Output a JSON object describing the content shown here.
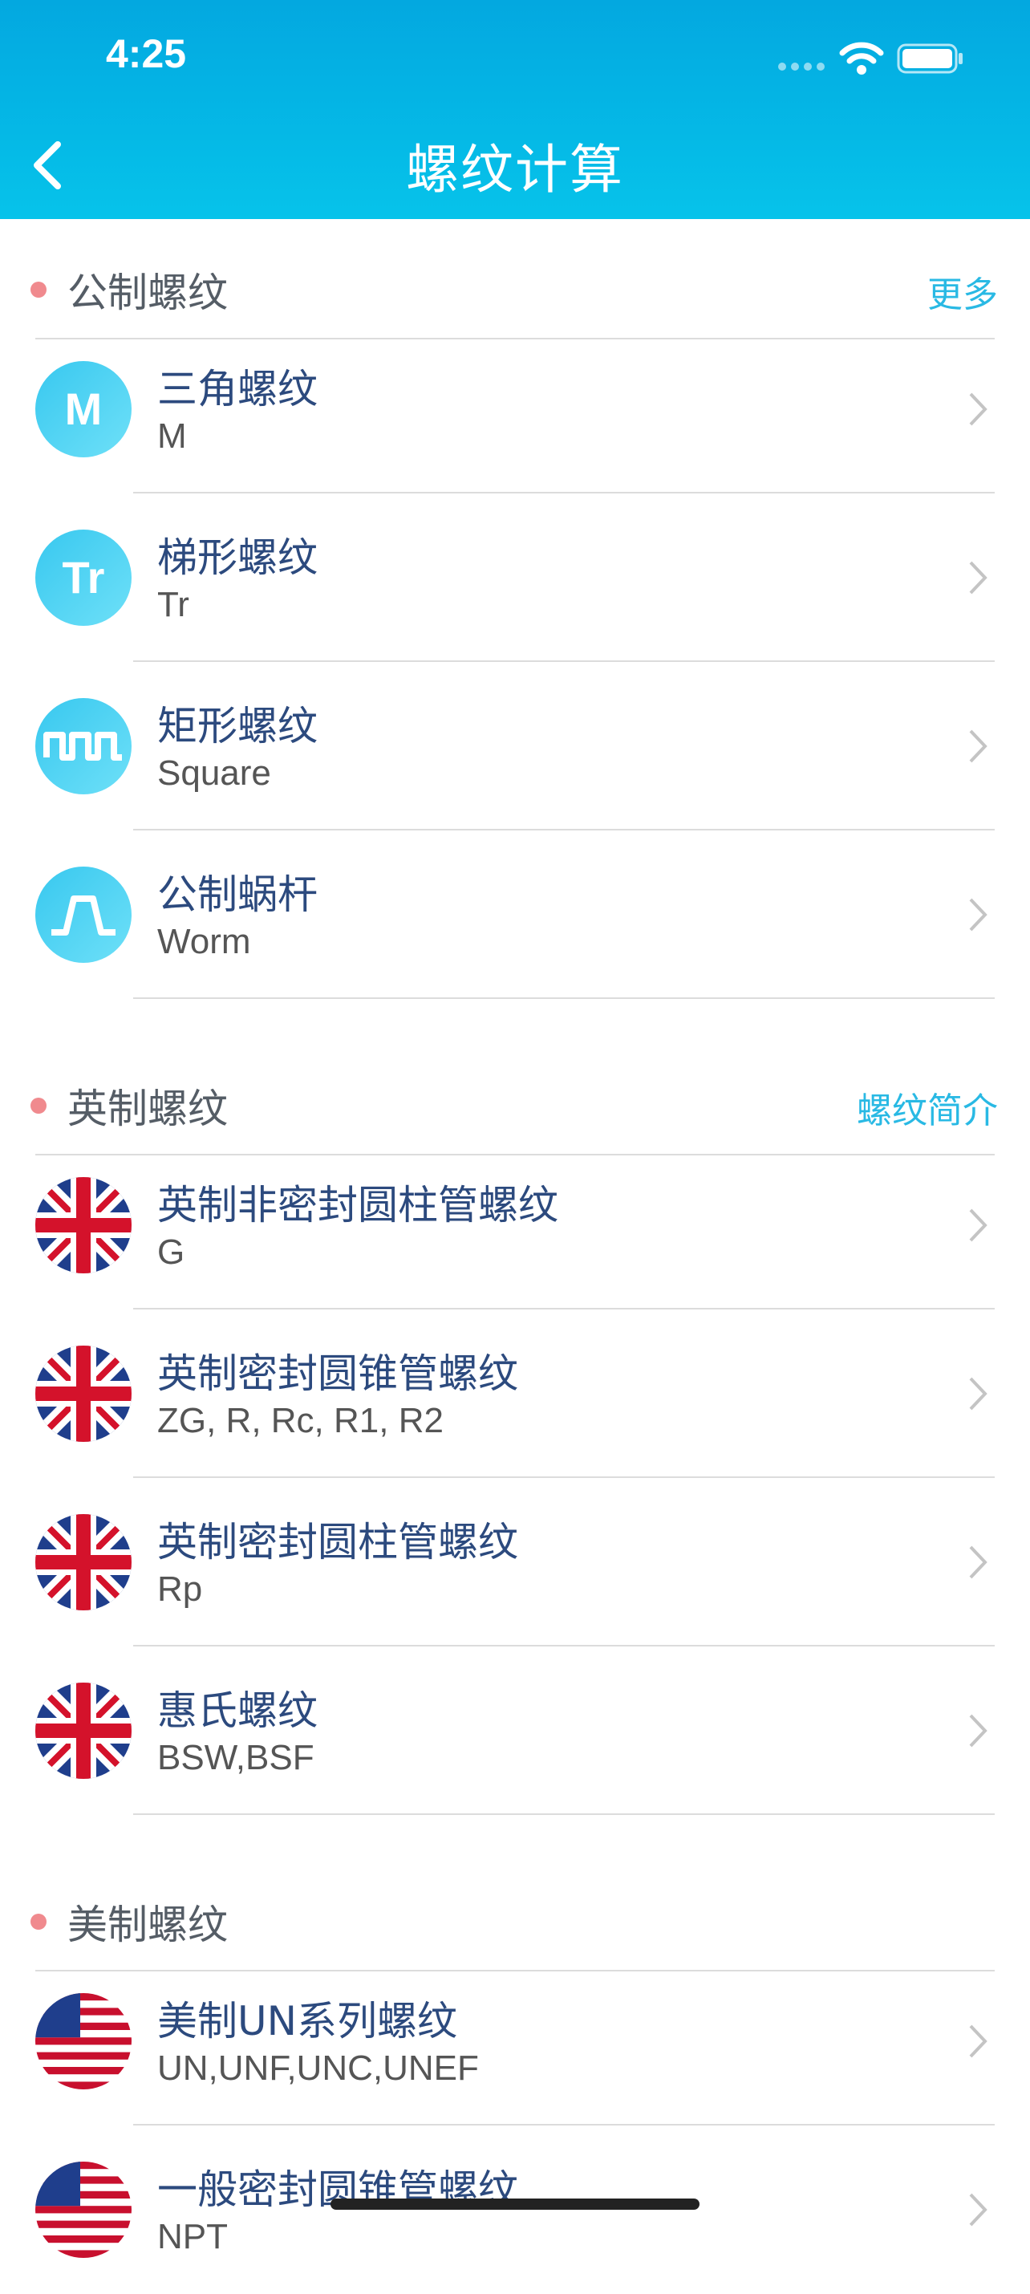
{
  "status_bar": {
    "time": "4:25"
  },
  "nav": {
    "title": "螺纹计算"
  },
  "sections": [
    {
      "title": "公制螺纹",
      "link": "更多",
      "items": [
        {
          "icon": "letter-m-icon",
          "letters": "M",
          "title": "三角螺纹",
          "subtitle": "M"
        },
        {
          "icon": "letter-tr-icon",
          "letters": "Tr",
          "title": "梯形螺纹",
          "subtitle": "Tr"
        },
        {
          "icon": "square-wave-icon",
          "title": "矩形螺纹",
          "subtitle": "Square"
        },
        {
          "icon": "worm-profile-icon",
          "title": "公制蜗杆",
          "subtitle": "Worm"
        }
      ]
    },
    {
      "title": "英制螺纹",
      "link": "螺纹简介",
      "items": [
        {
          "icon": "uk-flag-icon",
          "title": "英制非密封圆柱管螺纹",
          "subtitle": "G"
        },
        {
          "icon": "uk-flag-icon",
          "title": "英制密封圆锥管螺纹",
          "subtitle": "ZG, R, Rc, R1, R2"
        },
        {
          "icon": "uk-flag-icon",
          "title": "英制密封圆柱管螺纹",
          "subtitle": "Rp"
        },
        {
          "icon": "uk-flag-icon",
          "title": "惠氏螺纹",
          "subtitle": "BSW,BSF"
        }
      ]
    },
    {
      "title": "美制螺纹",
      "items": [
        {
          "icon": "us-flag-icon",
          "title": "美制UN系列螺纹",
          "subtitle": "UN,UNF,UNC,UNEF"
        },
        {
          "icon": "us-flag-icon",
          "title": "一般密封圆锥管螺纹",
          "subtitle": "NPT"
        }
      ]
    }
  ],
  "colors": {
    "header_top": "#03a8e0",
    "header_bottom": "#06c3ea",
    "accent_link": "#29b9e4",
    "section_dot": "#f08a8e",
    "item_title": "#2c4a7e"
  }
}
